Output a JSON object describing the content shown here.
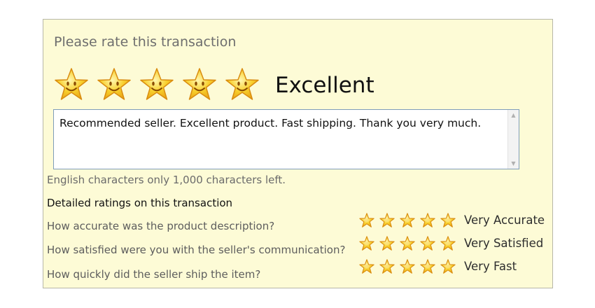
{
  "header": {
    "title": "Please rate this transaction"
  },
  "overall": {
    "stars": 5,
    "max_stars": 5,
    "label": "Excellent"
  },
  "comment": {
    "text": "Recommended seller.  Excellent product.  Fast shipping. Thank you very much."
  },
  "chars_left": "English characters only 1,000 characters left.",
  "detailed": {
    "heading": "Detailed ratings on this transaction",
    "rows": [
      {
        "question": "How accurate was the product description?",
        "stars": 5,
        "max_stars": 5,
        "label": "Very Accurate"
      },
      {
        "question": "How satisfied were you with the seller's communication?",
        "stars": 5,
        "max_stars": 5,
        "label": "Very Satisfied"
      },
      {
        "question": "How quickly did the seller ship the item?",
        "stars": 5,
        "max_stars": 5,
        "label": "Very Fast"
      }
    ]
  },
  "colors": {
    "star_fill": "#f7c21b",
    "star_outline": "#d98c10",
    "panel_bg": "#fdfbd6"
  }
}
